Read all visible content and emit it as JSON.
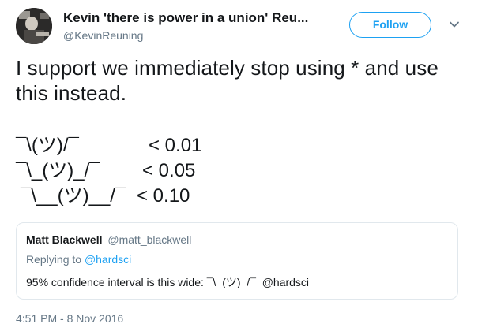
{
  "author": {
    "display_name": "Kevin 'there is power in a union' Reu...",
    "handle": "@KevinReuning",
    "avatar_icon": "avatar"
  },
  "follow_button": {
    "label": "Follow",
    "color": "#1da1f2"
  },
  "more_menu": {
    "icon": "chevron-down-icon"
  },
  "tweet": {
    "text": "I support we immediately stop using * and use this instead.",
    "shrug_rows": [
      {
        "face": "¯\\(ツ)/¯",
        "threshold": "< 0.01"
      },
      {
        "face": "¯\\_(ツ)_/¯",
        "threshold": "< 0.05"
      },
      {
        "face": "¯\\__(ツ)__/¯",
        "threshold": "< 0.10"
      }
    ]
  },
  "quoted_tweet": {
    "author_name": "Matt Blackwell",
    "author_handle": "@matt_blackwell",
    "replying_prefix": "Replying to",
    "replying_to": "@hardsci",
    "body": "95% confidence interval is this wide: ¯\\_(ツ)_/¯  @hardsci"
  },
  "timestamp": "4:51 PM - 8 Nov 2016",
  "colors": {
    "text": "#14171a",
    "secondary": "#657786",
    "accent": "#1da1f2",
    "border": "#e1e8ed"
  }
}
